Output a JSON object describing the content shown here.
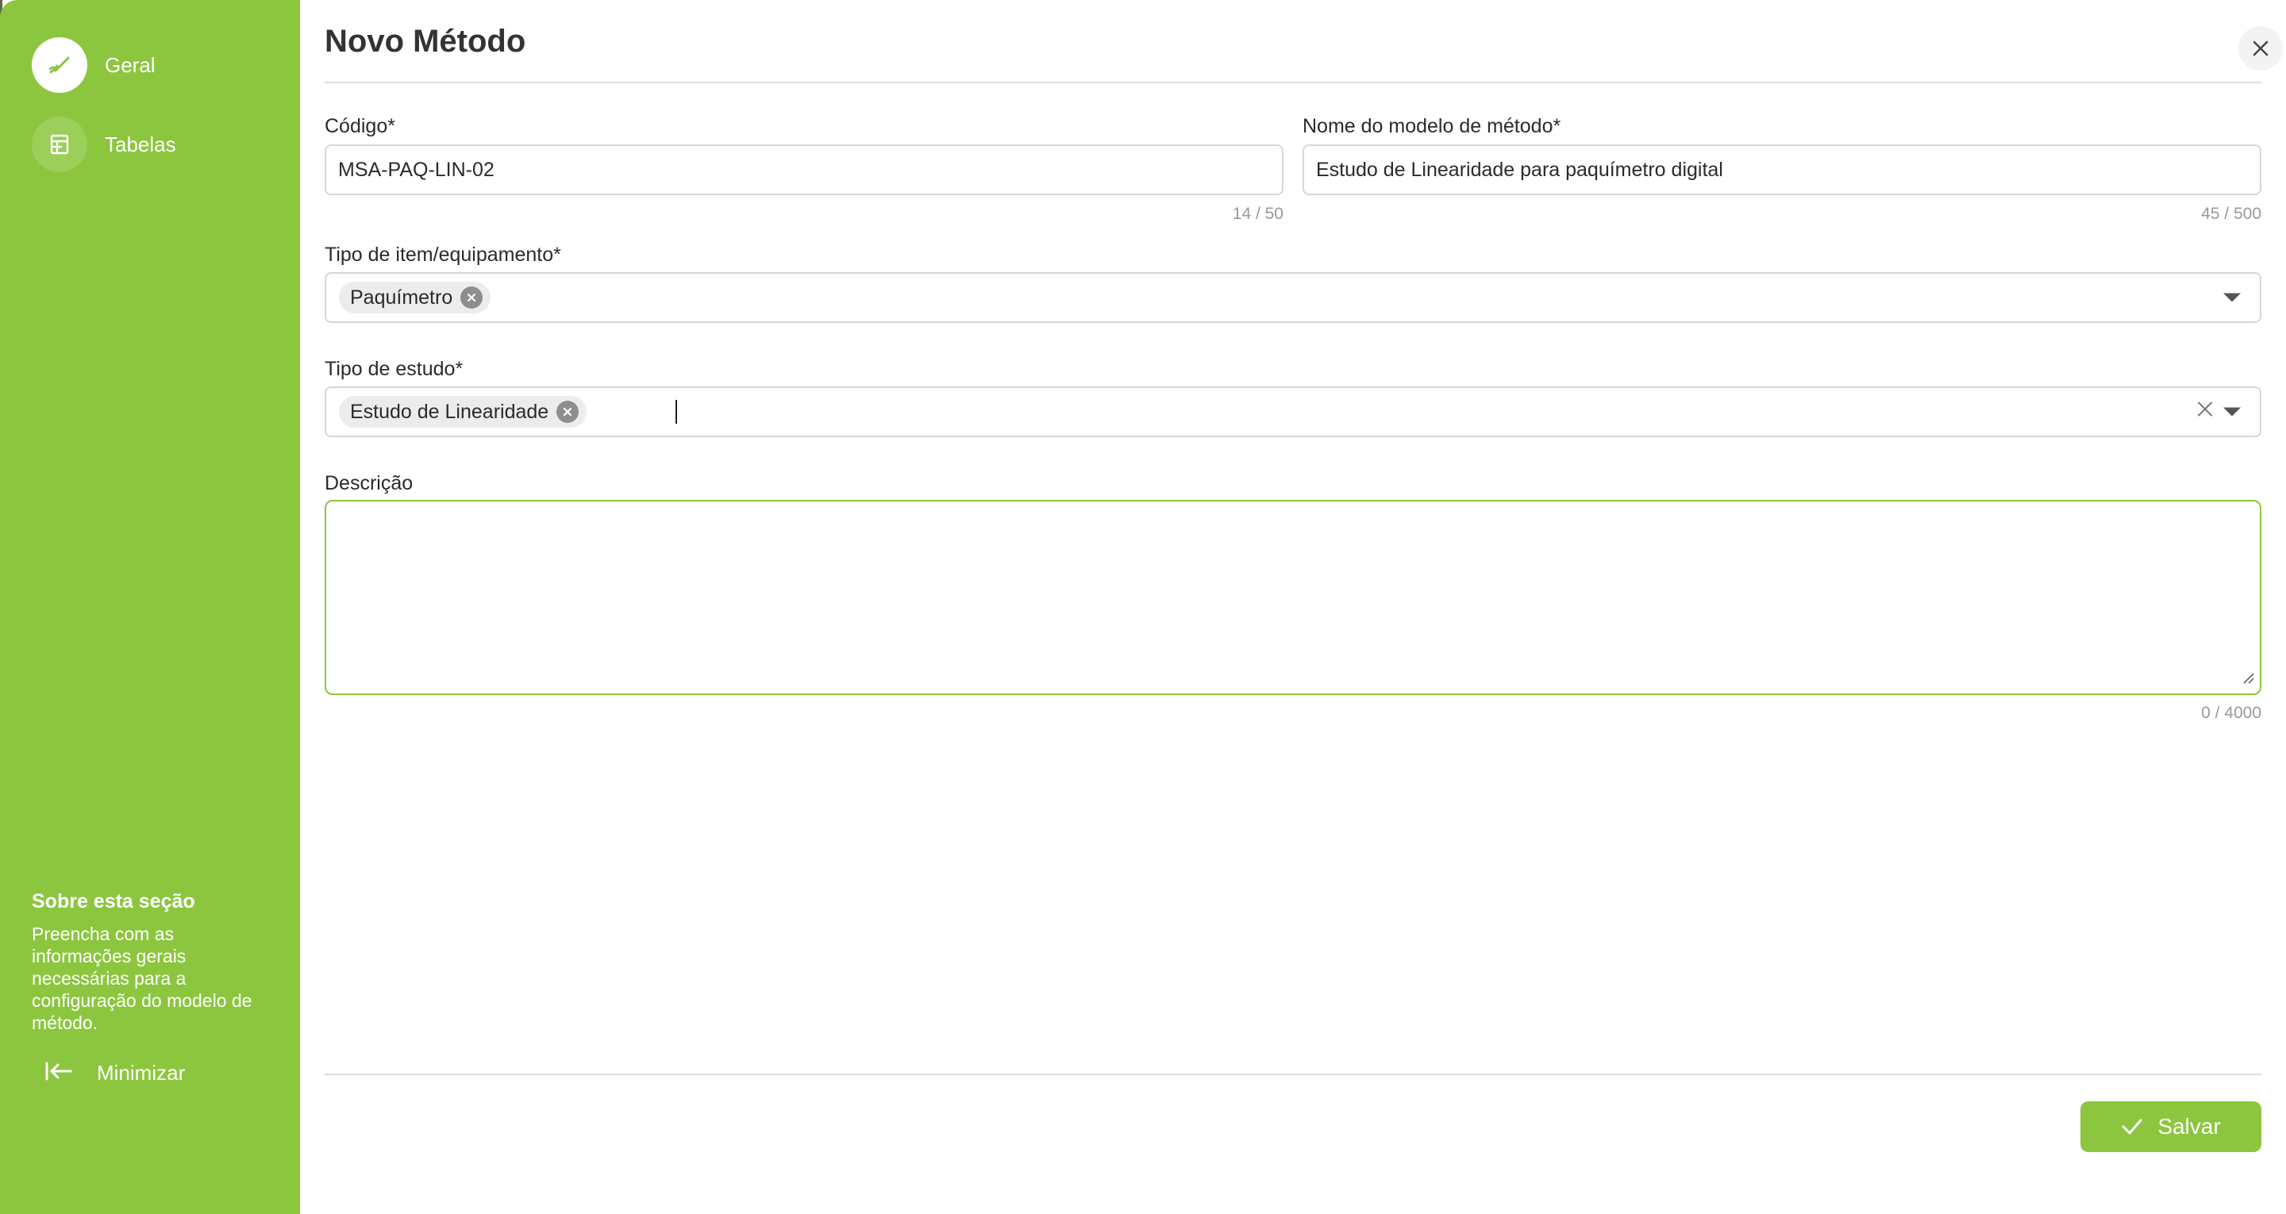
{
  "sidebar": {
    "items": [
      {
        "label": "Geral",
        "icon": "pen-link-icon",
        "active": true
      },
      {
        "label": "Tabelas",
        "icon": "table-icon",
        "active": false
      }
    ],
    "about_title": "Sobre esta seção",
    "about_text": "Preencha com as informações gerais necessárias para a configuração do modelo de método.",
    "minimize_label": "Minimizar"
  },
  "dialog": {
    "title": "Novo Método",
    "close_icon": "close-icon"
  },
  "form": {
    "codigo": {
      "label": "Código*",
      "value": "MSA-PAQ-LIN-02",
      "counter": "14 / 50"
    },
    "nome": {
      "label": "Nome do modelo de método*",
      "value": "Estudo de Linearidade para paquímetro digital",
      "counter": "45 / 500"
    },
    "tipo_item": {
      "label": "Tipo de item/equipamento*",
      "chips": [
        "Paquímetro"
      ]
    },
    "tipo_estudo": {
      "label": "Tipo de estudo*",
      "chips": [
        "Estudo de Linearidade"
      ]
    },
    "descricao": {
      "label": "Descrição",
      "value": "",
      "counter": "0 / 4000"
    }
  },
  "footer": {
    "save_label": "Salvar"
  },
  "colors": {
    "accent": "#8cc63f",
    "border": "#d7d7d7",
    "muted": "#999999"
  }
}
